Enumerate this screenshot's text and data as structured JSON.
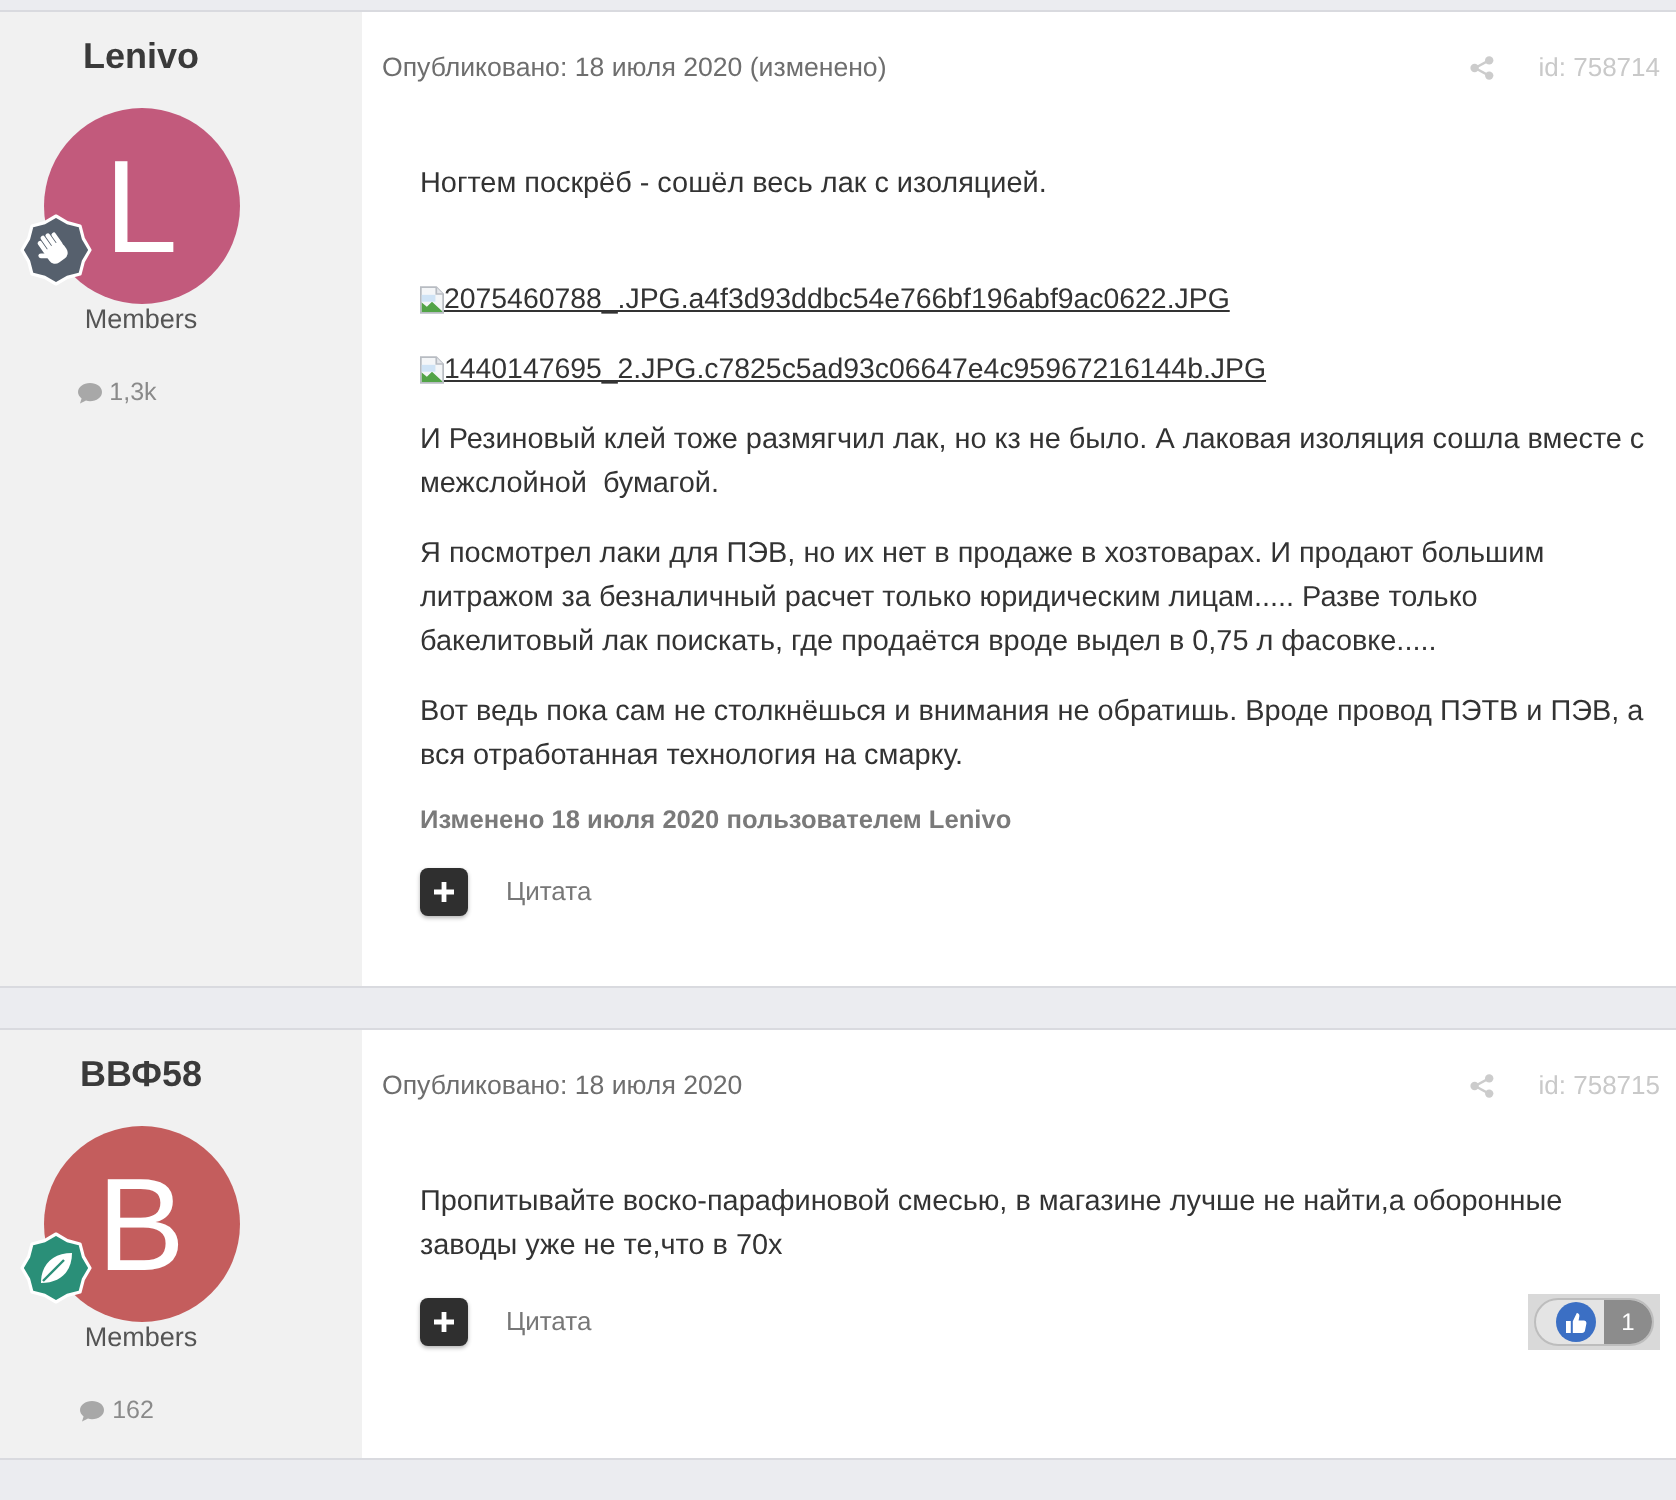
{
  "posts": [
    {
      "author": {
        "name": "Lenivo",
        "initial": "L",
        "color": "#c25a7c",
        "badge": {
          "kind": "hand"
        },
        "group": "Members",
        "post_count": "1,3k"
      },
      "published": "Опубликовано: 18 июля 2020 (изменено)",
      "post_id": "id: 758714",
      "content": [
        {
          "kind": "text",
          "text": "Ногтем поскрёб - сошёл весь лак с изоляцией."
        },
        {
          "kind": "image_link",
          "text": "2075460788_.JPG.a4f3d93ddbc54e766bf196abf9ac0622.JPG"
        },
        {
          "kind": "image_link",
          "text": "1440147695_2.JPG.c7825c5ad93c06647e4c95967216144b.JPG"
        },
        {
          "kind": "text",
          "text": "И Резиновый клей тоже размягчил лак, но кз не было. А лаковая изоляция сошла вместе с межслойной  бумагой."
        },
        {
          "kind": "text",
          "text": "Я посмотрел лаки для ПЭВ, но их нет в продаже в хозтоварах. И продают большим литражом за безналичный расчет только юридическим лицам..... Разве только бакелитовый лак поискать, где продаётся вроде выдел в 0,75 л фасовке....."
        },
        {
          "kind": "text",
          "text": "Вот ведь пока сам не столкнёшься и внимания не обратишь. Вроде провод ПЭТВ и ПЭВ, а вся отработанная технология на смарку."
        }
      ],
      "edited_note": "Изменено 18 июля 2020 пользователем Lenivo",
      "quote_label": "Цитата"
    },
    {
      "author": {
        "name": "ВВФ58",
        "initial": "B",
        "color": "#c45d5d",
        "badge": {
          "kind": "leaf"
        },
        "group": "Members",
        "post_count": "162"
      },
      "published": "Опубликовано: 18 июля 2020",
      "post_id": "id: 758715",
      "content": [
        {
          "kind": "text",
          "text": "Пропитывайте воско-парафиновой смесью, в магазине лучше не найти,а оборонные заводы уже не те,что в 70х"
        }
      ],
      "quote_label": "Цитата",
      "reactions": {
        "count": "1"
      }
    }
  ]
}
